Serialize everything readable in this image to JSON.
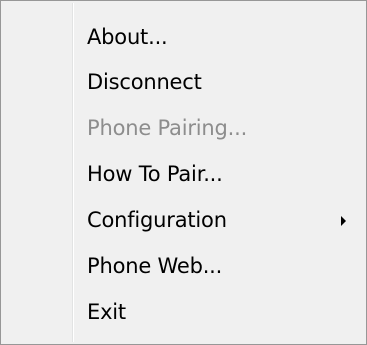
{
  "menu": {
    "items": [
      {
        "label": "About...",
        "enabled": true,
        "has_submenu": false
      },
      {
        "label": "Disconnect",
        "enabled": true,
        "has_submenu": false
      },
      {
        "label": "Phone Pairing...",
        "enabled": false,
        "has_submenu": false
      },
      {
        "label": "How To Pair...",
        "enabled": true,
        "has_submenu": false
      },
      {
        "label": "Configuration",
        "enabled": true,
        "has_submenu": true,
        "submenu_icon": "chevron-right-icon"
      },
      {
        "label": "Phone Web...",
        "enabled": true,
        "has_submenu": false
      },
      {
        "label": "Exit",
        "enabled": true,
        "has_submenu": false
      }
    ]
  },
  "colors": {
    "menu_background": "#f0f0f0",
    "menu_border": "#979797",
    "text": "#000000",
    "disabled_text": "#8d8d8d"
  }
}
